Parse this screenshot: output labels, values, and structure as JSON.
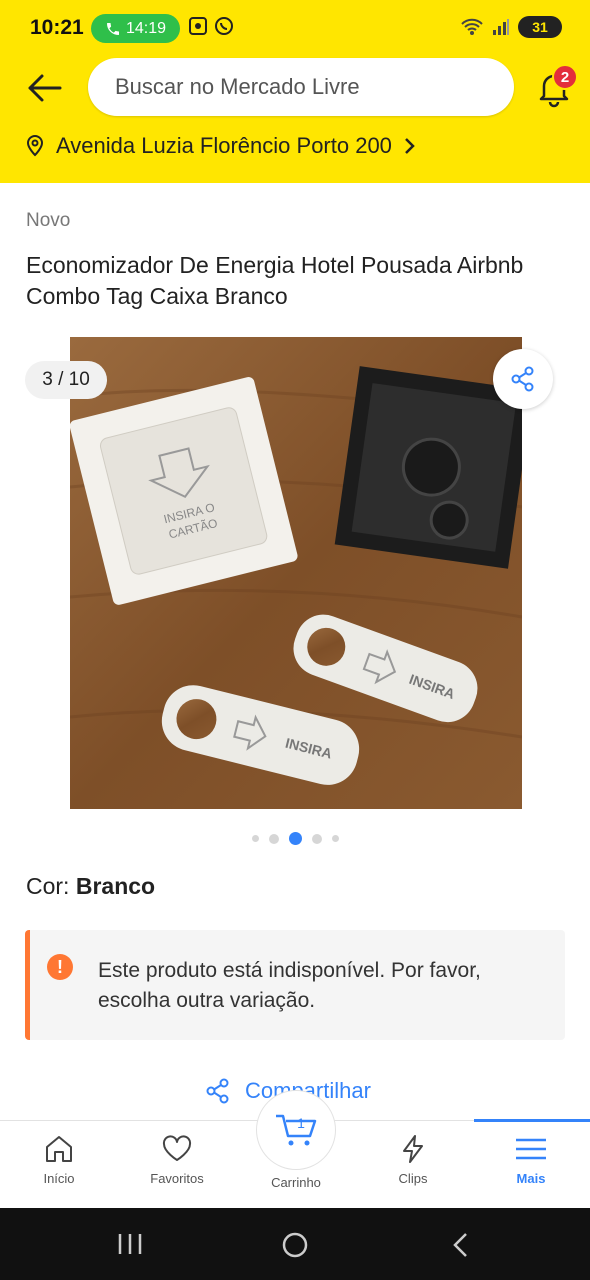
{
  "status_bar": {
    "time": "10:21",
    "call_timer": "14:19",
    "battery": "31"
  },
  "header": {
    "search_placeholder": "Buscar no Mercado Livre",
    "notifications_count": "2",
    "address": "Avenida Luzia Florêncio Porto 200"
  },
  "product": {
    "condition": "Novo",
    "title": "Economizador De Energia Hotel Pousada Airbnb Combo Tag Caixa Branco",
    "image_counter": "3 / 10",
    "image_texts": {
      "switch_line1": "INSIRA O",
      "switch_line2": "CARTÃO",
      "tag_text": "INSIRA"
    },
    "gallery_dots": {
      "total": 5,
      "active": 3
    },
    "color_label": "Cor:",
    "color_value": "Branco",
    "alert_text": "Este produto está indisponível. Por favor, escolha outra variação.",
    "share_label": "Compartilhar"
  },
  "bottom_nav": {
    "items": [
      {
        "label": "Início",
        "icon": "home-icon"
      },
      {
        "label": "Favoritos",
        "icon": "heart-icon"
      },
      {
        "label": "Carrinho",
        "icon": "cart-icon",
        "count": "1"
      },
      {
        "label": "Clips",
        "icon": "bolt-icon"
      },
      {
        "label": "Mais",
        "icon": "menu-icon",
        "active": true
      }
    ]
  },
  "colors": {
    "brand_yellow": "#ffe600",
    "accent_blue": "#3483fa",
    "alert_orange": "#ff7733",
    "badge_red": "#e32e3b"
  }
}
